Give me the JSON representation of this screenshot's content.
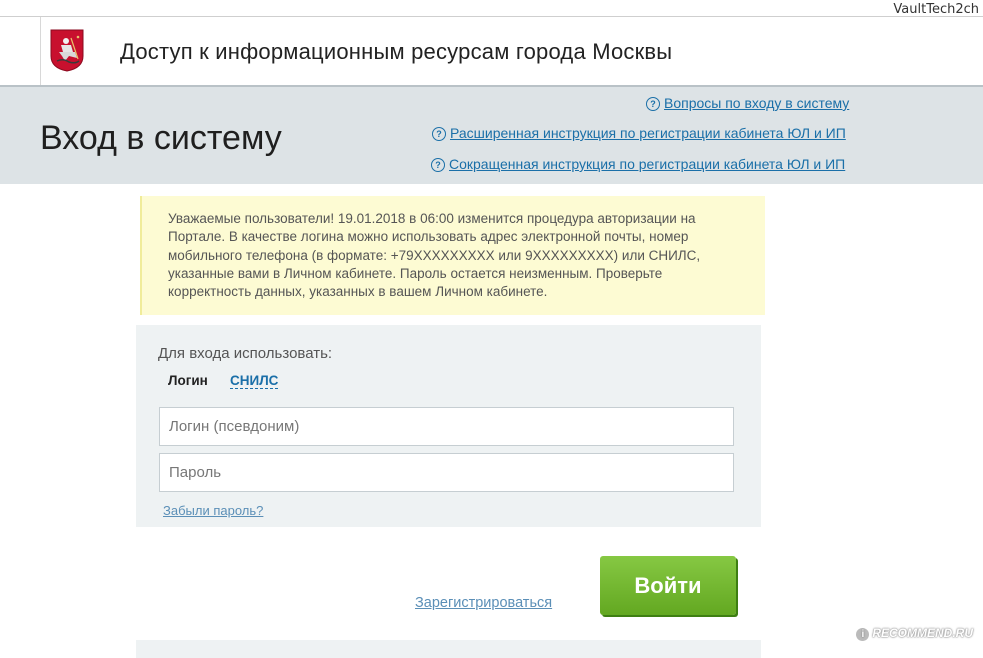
{
  "watermarks": {
    "top": "VaultTech2ch",
    "bottom": "RECOMMEND.RU"
  },
  "header": {
    "title": "Доступ к информационным ресурсам города Москвы",
    "logo_icon": "moscow-coat-of-arms-icon"
  },
  "band": {
    "page_title": "Вход в систему",
    "links": [
      "Вопросы по входу в систему",
      "Расширенная инструкция по регистрации кабинета ЮЛ и ИП",
      "Сокращенная инструкция по регистрации кабинета ЮЛ и ИП"
    ]
  },
  "notice": {
    "text": "Уважаемые пользователи! 19.01.2018 в 06:00 изменится процедура авторизации на Портале. В качестве логина можно использовать адрес электронной почты, номер мобильного телефона (в формате: +79XXXXXXXXX или 9XXXXXXXXX) или СНИЛС, указанные вами в Личном кабинете. Пароль остается неизменным. Проверьте корректность данных, указанных в вашем Личном кабинете."
  },
  "form": {
    "use_label": "Для входа использовать:",
    "tabs": [
      "Логин",
      "СНИЛС"
    ],
    "login_placeholder": "Логин (псевдоним)",
    "password_placeholder": "Пароль",
    "login_value": "",
    "password_value": "",
    "forgot_label": "Забыли пароль?"
  },
  "actions": {
    "register_label": "Зарегистрироваться",
    "login_button_label": "Войти"
  },
  "colors": {
    "link": "#1a6fa8",
    "band": "#dde3e6",
    "notice_bg": "#fdfbd3",
    "button_green": "#6bb12a"
  }
}
